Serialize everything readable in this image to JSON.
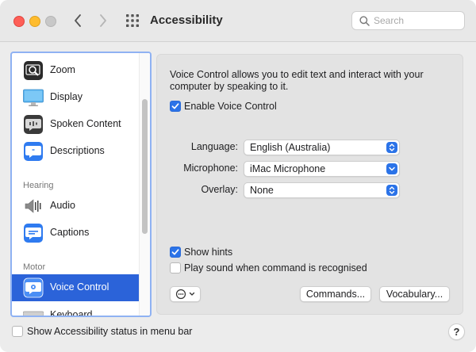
{
  "window": {
    "title": "Accessibility"
  },
  "search": {
    "placeholder": "Search"
  },
  "sidebar": {
    "items": [
      {
        "label": "Zoom",
        "icon": "zoom-icon"
      },
      {
        "label": "Display",
        "icon": "display-icon"
      },
      {
        "label": "Spoken Content",
        "icon": "spoken-content-icon"
      },
      {
        "label": "Descriptions",
        "icon": "descriptions-icon"
      },
      {
        "label": "Audio",
        "icon": "audio-icon"
      },
      {
        "label": "Captions",
        "icon": "captions-icon"
      },
      {
        "label": "Voice Control",
        "icon": "voice-control-icon",
        "selected": true
      },
      {
        "label": "Keyboard",
        "icon": "keyboard-icon"
      }
    ],
    "headers": {
      "hearing": "Hearing",
      "motor": "Motor"
    }
  },
  "main": {
    "description": "Voice Control allows you to edit text and interact with your computer by speaking to it.",
    "enable_voice_control": {
      "label": "Enable Voice Control",
      "checked": true
    },
    "fields": {
      "language": {
        "label": "Language:",
        "value": "English (Australia)"
      },
      "microphone": {
        "label": "Microphone:",
        "value": "iMac Microphone"
      },
      "overlay": {
        "label": "Overlay:",
        "value": "None"
      }
    },
    "show_hints": {
      "label": "Show hints",
      "checked": true
    },
    "play_sound": {
      "label": "Play sound when command is recognised",
      "checked": false
    },
    "buttons": {
      "commands": "Commands...",
      "vocabulary": "Vocabulary..."
    }
  },
  "footer": {
    "status_checkbox": {
      "label": "Show Accessibility status in menu bar",
      "checked": false
    },
    "help": "?"
  },
  "colors": {
    "accent": "#2b73e8",
    "selection": "#2b63d9"
  }
}
